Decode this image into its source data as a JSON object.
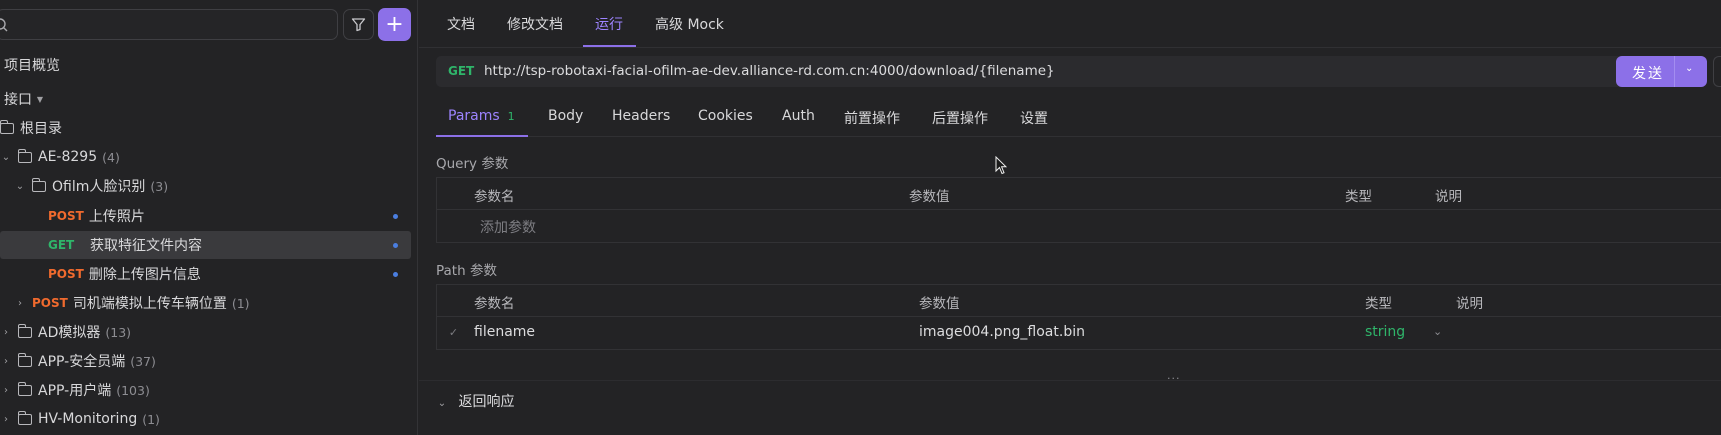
{
  "sidebar": {
    "search": {
      "placeholder": "",
      "value": ""
    },
    "overview": "项目概览",
    "interfaces": "接口",
    "root": "根目录",
    "tree": [
      {
        "type": "folder",
        "label": "AE-8295",
        "count": "(4)"
      },
      {
        "type": "folder",
        "label": "Ofilm人脸识别",
        "count": "(3)"
      },
      {
        "type": "api",
        "method": "POST",
        "label": "上传照片"
      },
      {
        "type": "api",
        "method": "GET",
        "label": "获取特征文件内容"
      },
      {
        "type": "api",
        "method": "POST",
        "label": "删除上传图片信息"
      },
      {
        "type": "api",
        "method": "POST",
        "label": "司机端模拟上传车辆位置",
        "count": "(1)"
      },
      {
        "type": "folder",
        "label": "AD模拟器",
        "count": "(13)"
      },
      {
        "type": "folder",
        "label": "APP-安全员端",
        "count": "(37)"
      },
      {
        "type": "folder",
        "label": "APP-用户端",
        "count": "(103)"
      },
      {
        "type": "folder",
        "label": "HV-Monitoring",
        "count": "(1)"
      }
    ]
  },
  "top_tabs": [
    "文档",
    "修改文档",
    "运行",
    "高级 Mock"
  ],
  "active_top_tab": "运行",
  "request": {
    "method": "GET",
    "url": "http://tsp-robotaxi-facial-ofilm-ae-dev.alliance-rd.com.cn:4000/download/{filename}",
    "send_label": "发送"
  },
  "sub_tabs": [
    {
      "label": "Params",
      "badge": "1"
    },
    {
      "label": "Body"
    },
    {
      "label": "Headers"
    },
    {
      "label": "Cookies"
    },
    {
      "label": "Auth"
    },
    {
      "label": "前置操作"
    },
    {
      "label": "后置操作"
    },
    {
      "label": "设置"
    }
  ],
  "query": {
    "title": "Query 参数",
    "headers": [
      "参数名",
      "参数值",
      "类型",
      "说明"
    ],
    "add_placeholder": "添加参数"
  },
  "path": {
    "title": "Path 参数",
    "headers": [
      "参数名",
      "参数值",
      "类型",
      "说明"
    ],
    "rows": [
      {
        "name": "filename",
        "value": "image004.png_float.bin",
        "type": "string",
        "desc": ""
      }
    ]
  },
  "response": {
    "label": "返回响应"
  },
  "colors": {
    "accent": "#8c70e8",
    "get": "#2fb56a",
    "post": "#f06a2e",
    "background": "#232325"
  }
}
